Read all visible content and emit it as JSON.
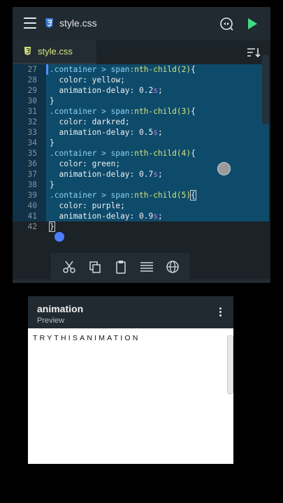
{
  "editor": {
    "file_title": "style.css",
    "tab_label": "style.css",
    "icons": {
      "menu": "hamburger-menu-icon",
      "file_type": "css3-icon",
      "search": "search-replace-icon",
      "run": "play-icon",
      "sort": "sort-icon"
    },
    "lines": [
      {
        "n": "27",
        "selector": ".container > span",
        "pseudo": ":nth-child(2)",
        "brace": "{"
      },
      {
        "n": "28",
        "prop": "color",
        "value": "yellow"
      },
      {
        "n": "29",
        "prop": "animation-delay",
        "num": "0.2",
        "unit": "s"
      },
      {
        "n": "30",
        "close": "}"
      },
      {
        "n": "31",
        "selector": ".container > span",
        "pseudo": ":nth-child(3)",
        "brace": "{"
      },
      {
        "n": "32",
        "prop": "color",
        "value": "darkred"
      },
      {
        "n": "33",
        "prop": "animation-delay",
        "num": "0.5",
        "unit": "s"
      },
      {
        "n": "34",
        "close": "}"
      },
      {
        "n": "35",
        "selector": ".container > span",
        "pseudo": ":nth-child(4)",
        "brace": "{"
      },
      {
        "n": "36",
        "prop": "color",
        "value": "green"
      },
      {
        "n": "37",
        "prop": "animation-delay",
        "num": "0.7",
        "unit": "s"
      },
      {
        "n": "38",
        "close": "}"
      },
      {
        "n": "39",
        "selector": ".container > span",
        "pseudo": ":nth-child(5)",
        "brace": "{"
      },
      {
        "n": "40",
        "prop": "color",
        "value": "purple"
      },
      {
        "n": "41",
        "prop": "animation-delay",
        "num": "0.9",
        "unit": "s"
      },
      {
        "n": "42",
        "close": "}"
      }
    ],
    "toolbar": [
      "cut-icon",
      "copy-icon",
      "paste-icon",
      "select-all-icon",
      "globe-icon"
    ],
    "colors": {
      "selection": "#0e4b6b",
      "accent": "#4b7fff",
      "run": "#3ddc84"
    }
  },
  "preview": {
    "title": "animation",
    "subtitle": "Preview",
    "more_icon": "more-vert-icon",
    "content": "TRYTHISANIMATION"
  }
}
